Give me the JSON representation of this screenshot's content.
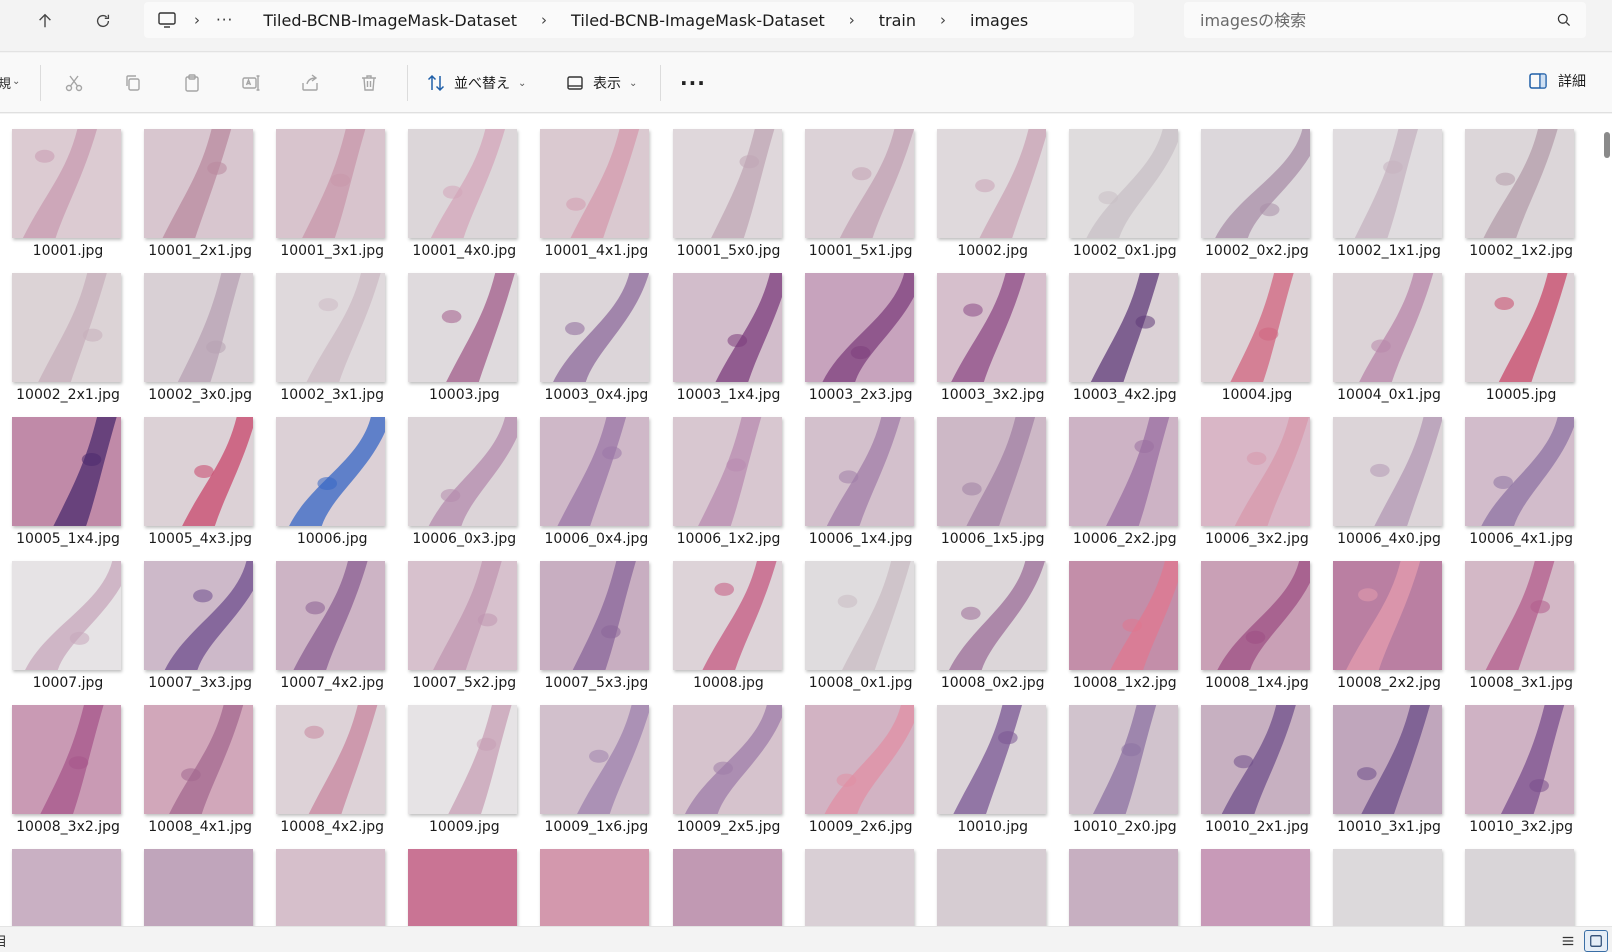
{
  "breadcrumb": {
    "overflow": "···",
    "items": [
      "Tiled-BCNB-ImageMask-Dataset",
      "Tiled-BCNB-ImageMask-Dataset",
      "train",
      "images"
    ]
  },
  "search": {
    "placeholder": "imagesの検索"
  },
  "toolbar": {
    "partial_label": "規",
    "sort_label": "並べ替え",
    "view_label": "表示",
    "details_label": "詳細"
  },
  "status": {
    "left_text": "目"
  },
  "files": [
    {
      "name": "10001.jpg",
      "tone": "#dccbd2",
      "mark": "#c89bb0"
    },
    {
      "name": "10001_2x1.jpg",
      "tone": "#d8c6cf",
      "mark": "#b9899f"
    },
    {
      "name": "10001_3x1.jpg",
      "tone": "#d8c4cd",
      "mark": "#c897a9"
    },
    {
      "name": "10001_4x0.jpg",
      "tone": "#dcd6d9",
      "mark": "#d4a5b9"
    },
    {
      "name": "10001_4x1.jpg",
      "tone": "#dac9d0",
      "mark": "#d49aae"
    },
    {
      "name": "10001_5x0.jpg",
      "tone": "#dfd7db",
      "mark": "#bfa6b4"
    },
    {
      "name": "10001_5x1.jpg",
      "tone": "#dcd2d7",
      "mark": "#c2a0b3"
    },
    {
      "name": "10002.jpg",
      "tone": "#dfd9dc",
      "mark": "#c9a3b6"
    },
    {
      "name": "10002_0x1.jpg",
      "tone": "#dfdcdd",
      "mark": "#c8c0c5"
    },
    {
      "name": "10002_0x2.jpg",
      "tone": "#dcd7db",
      "mark": "#a98fa8"
    },
    {
      "name": "10002_1x1.jpg",
      "tone": "#e0dcdf",
      "mark": "#c6b3c0"
    },
    {
      "name": "10002_1x2.jpg",
      "tone": "#dcd6d9",
      "mark": "#b49ca9"
    },
    {
      "name": "10002_2x1.jpg",
      "tone": "#dcd3d6",
      "mark": "#c7afbb"
    },
    {
      "name": "10002_3x0.jpg",
      "tone": "#d9d0d5",
      "mark": "#b7a2b3"
    },
    {
      "name": "10002_3x1.jpg",
      "tone": "#dfd9dc",
      "mark": "#ccbac4"
    },
    {
      "name": "10003.jpg",
      "tone": "#dfdadd",
      "mark": "#a25c8a"
    },
    {
      "name": "10003_0x4.jpg",
      "tone": "#dcd5d9",
      "mark": "#8e6a9b"
    },
    {
      "name": "10003_1x4.jpg",
      "tone": "#d2bdcb",
      "mark": "#7b3c7c"
    },
    {
      "name": "10003_2x3.jpg",
      "tone": "#c7a3bd",
      "mark": "#7e3f7d"
    },
    {
      "name": "10003_3x2.jpg",
      "tone": "#d6bfcc",
      "mark": "#8c4a86"
    },
    {
      "name": "10003_4x2.jpg",
      "tone": "#dbd1d6",
      "mark": "#5f3a78"
    },
    {
      "name": "10004.jpg",
      "tone": "#ddd2d6",
      "mark": "#d0647f"
    },
    {
      "name": "10004_0x1.jpg",
      "tone": "#dcd3d7",
      "mark": "#b886a9"
    },
    {
      "name": "10005.jpg",
      "tone": "#dcd3d7",
      "mark": "#c8486a"
    },
    {
      "name": "10005_1x4.jpg",
      "tone": "#c08aa8",
      "mark": "#4b2a6d"
    },
    {
      "name": "10005_4x3.jpg",
      "tone": "#dcd1d6",
      "mark": "#c8466b"
    },
    {
      "name": "10006.jpg",
      "tone": "#dcd0d6",
      "mark": "#3566c4"
    },
    {
      "name": "10006_0x3.jpg",
      "tone": "#dcd4d8",
      "mark": "#b48bad"
    },
    {
      "name": "10006_0x4.jpg",
      "tone": "#cfb8c8",
      "mark": "#9b77a7"
    },
    {
      "name": "10006_1x2.jpg",
      "tone": "#d8c7d0",
      "mark": "#b88bb0"
    },
    {
      "name": "10006_1x4.jpg",
      "tone": "#d3c0cc",
      "mark": "#a17ea8"
    },
    {
      "name": "10006_1x5.jpg",
      "tone": "#cdb8c6",
      "mark": "#a182a4"
    },
    {
      "name": "10006_2x2.jpg",
      "tone": "#cdb3c5",
      "mark": "#9a6fa1"
    },
    {
      "name": "10006_3x2.jpg",
      "tone": "#d9b6c6",
      "mark": "#d798ab"
    },
    {
      "name": "10006_4x0.jpg",
      "tone": "#dcd4d8",
      "mark": "#b398b4"
    },
    {
      "name": "10006_4x1.jpg",
      "tone": "#d2bccb",
      "mark": "#8d73a3"
    },
    {
      "name": "10007.jpg",
      "tone": "#e6e3e5",
      "mark": "#c7a7bb"
    },
    {
      "name": "10007_3x3.jpg",
      "tone": "#cdb9c9",
      "mark": "#6e4d8c"
    },
    {
      "name": "10007_4x2.jpg",
      "tone": "#cdb4c5",
      "mark": "#8a5f91"
    },
    {
      "name": "10007_5x2.jpg",
      "tone": "#d7c1cd",
      "mark": "#c095b0"
    },
    {
      "name": "10007_5x3.jpg",
      "tone": "#c8aec1",
      "mark": "#8a6699"
    },
    {
      "name": "10008.jpg",
      "tone": "#ddd3d8",
      "mark": "#c45a82"
    },
    {
      "name": "10008_0x1.jpg",
      "tone": "#dfdcde",
      "mark": "#c9bcc3"
    },
    {
      "name": "10008_0x2.jpg",
      "tone": "#dcd6d9",
      "mark": "#9c6d98"
    },
    {
      "name": "10008_1x2.jpg",
      "tone": "#c38ea9",
      "mark": "#e07790"
    },
    {
      "name": "10008_1x4.jpg",
      "tone": "#c9a0b6",
      "mark": "#9c4f83"
    },
    {
      "name": "10008_2x2.jpg",
      "tone": "#ba7fa2",
      "mark": "#e49cad"
    },
    {
      "name": "10008_3x1.jpg",
      "tone": "#d3b8c6",
      "mark": "#b35d8c"
    },
    {
      "name": "10008_3x2.jpg",
      "tone": "#c99ab4",
      "mark": "#a6558b"
    },
    {
      "name": "10008_4x1.jpg",
      "tone": "#d1a7ba",
      "mark": "#a3688f"
    },
    {
      "name": "10008_4x2.jpg",
      "tone": "#ddd2d7",
      "mark": "#c7869f"
    },
    {
      "name": "10009.jpg",
      "tone": "#e6e3e5",
      "mark": "#c79fb4"
    },
    {
      "name": "10009_1x6.jpg",
      "tone": "#d2c0cc",
      "mark": "#9e82ad"
    },
    {
      "name": "10009_2x5.jpg",
      "tone": "#d6c3cd",
      "mark": "#9e7ca8"
    },
    {
      "name": "10009_2x6.jpg",
      "tone": "#d2b3c3",
      "mark": "#e08fa4"
    },
    {
      "name": "10010.jpg",
      "tone": "#dcd5d9",
      "mark": "#7a5593"
    },
    {
      "name": "10010_2x0.jpg",
      "tone": "#d1c3cd",
      "mark": "#8c72a2"
    },
    {
      "name": "10010_2x1.jpg",
      "tone": "#c7b0c1",
      "mark": "#6f4f8a"
    },
    {
      "name": "10010_3x1.jpg",
      "tone": "#c0a6bc",
      "mark": "#6b4c88"
    },
    {
      "name": "10010_3x2.jpg",
      "tone": "#cfb2c4",
      "mark": "#7a4e8d"
    }
  ],
  "partial_row": [
    {
      "tone": "#c9b0c3"
    },
    {
      "tone": "#c0a5bb"
    },
    {
      "tone": "#d6bfcb"
    },
    {
      "tone": "#c97494"
    },
    {
      "tone": "#d398ad"
    },
    {
      "tone": "#c199b3"
    },
    {
      "tone": "#d9cfd5"
    },
    {
      "tone": "#d6ccd2"
    },
    {
      "tone": "#c7afc1"
    },
    {
      "tone": "#c89ab8"
    },
    {
      "tone": "#dcd9db"
    },
    {
      "tone": "#d9d5d8"
    }
  ]
}
